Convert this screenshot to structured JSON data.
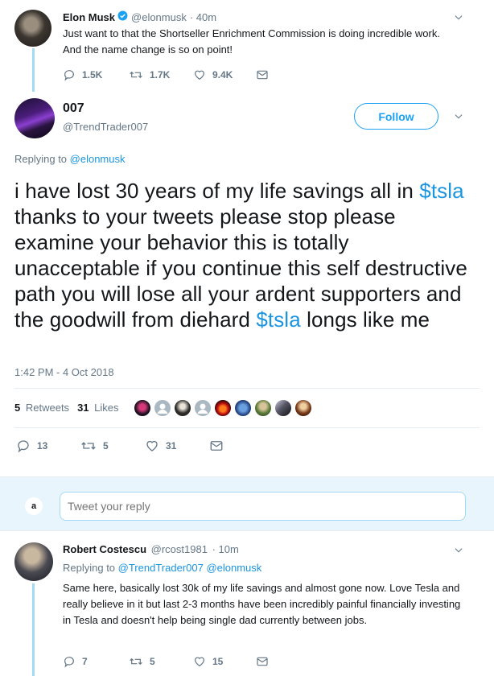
{
  "tweet1": {
    "name": "Elon Musk",
    "handle": "@elonmusk",
    "time": "· 40m",
    "text": "Just want to that the Shortseller Enrichment Commission is doing incredible work. And the name change is so on point!",
    "replies": "1.5K",
    "retweets": "1.7K",
    "likes": "9.4K"
  },
  "main": {
    "name": "007",
    "handle": "@TrendTrader007",
    "follow_label": "Follow",
    "replying_prefix": "Replying to ",
    "replying_to": "@elonmusk",
    "text_parts": [
      "i have lost 30 years of my life savings all in ",
      "$tsla",
      " thanks to your tweets please stop please examine your behavior this is totally unacceptable  if you continue this self destructive path you will lose all your ardent supporters and the goodwill from diehard ",
      "$tsla",
      " longs like me"
    ],
    "timestamp": "1:42 PM - 4 Oct 2018",
    "retweets_count": "5",
    "retweets_label": "Retweets",
    "likes_count": "31",
    "likes_label": "Likes",
    "replies": "13",
    "retweets": "5",
    "likes": "31"
  },
  "reply_box": {
    "placeholder": "Tweet your reply",
    "avatar_letter": "a"
  },
  "reply": {
    "name": "Robert Costescu",
    "handle": "@rcost1981",
    "time": "· 10m",
    "replying_prefix": "Replying to ",
    "replying_to": "@TrendTrader007 @elonmusk",
    "text": "Same here, basically lost 30k of my life savings and almost gone now. Love Tesla and really believe in it but last 2-3 months have been incredibly painful financially investing in Tesla and doesn't help being single dad currently between jobs.",
    "replies": "7",
    "retweets": "5",
    "likes": "15"
  },
  "colors": {
    "link": "#1b95e0",
    "muted": "#657786",
    "divider": "#e6ecf0",
    "thread_line": "#a4d9f5"
  }
}
